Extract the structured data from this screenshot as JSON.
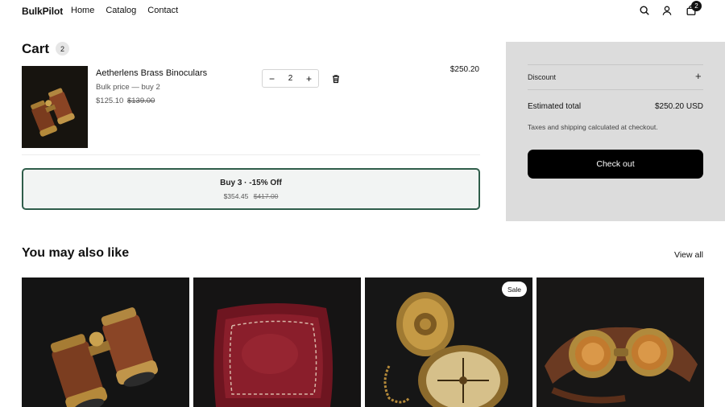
{
  "header": {
    "brand": "BulkPilot",
    "nav": [
      "Home",
      "Catalog",
      "Contact"
    ],
    "icons": [
      "search-icon",
      "account-icon",
      "cart-icon"
    ],
    "cart_count": "2"
  },
  "cart": {
    "title": "Cart",
    "count": "2",
    "item": {
      "name": "Aetherlens Brass Binoculars",
      "bulk_label": "Bulk price — buy 2",
      "price": "$125.10",
      "compare_price": "$139.00",
      "quantity": "2",
      "line_total": "$250.20"
    },
    "offer": {
      "title": "Buy 3 · -15% Off",
      "price": "$354.45",
      "compare_price": "$417.00"
    }
  },
  "summary": {
    "discount_label": "Discount",
    "estimated_total_label": "Estimated total",
    "estimated_total_value": "$250.20 USD",
    "taxes_note": "Taxes and shipping calculated at checkout.",
    "checkout_label": "Check out"
  },
  "recommendations": {
    "title": "You may also like",
    "view_all": "View all",
    "sale_badge": "Sale",
    "products": [
      "binoculars",
      "velvet-pillow",
      "pocket-compass",
      "leather-goggles"
    ]
  },
  "colors": {
    "offer_border": "#2f5d4a",
    "summary_bg": "#dcdcdc",
    "checkout_bg": "#000000"
  }
}
